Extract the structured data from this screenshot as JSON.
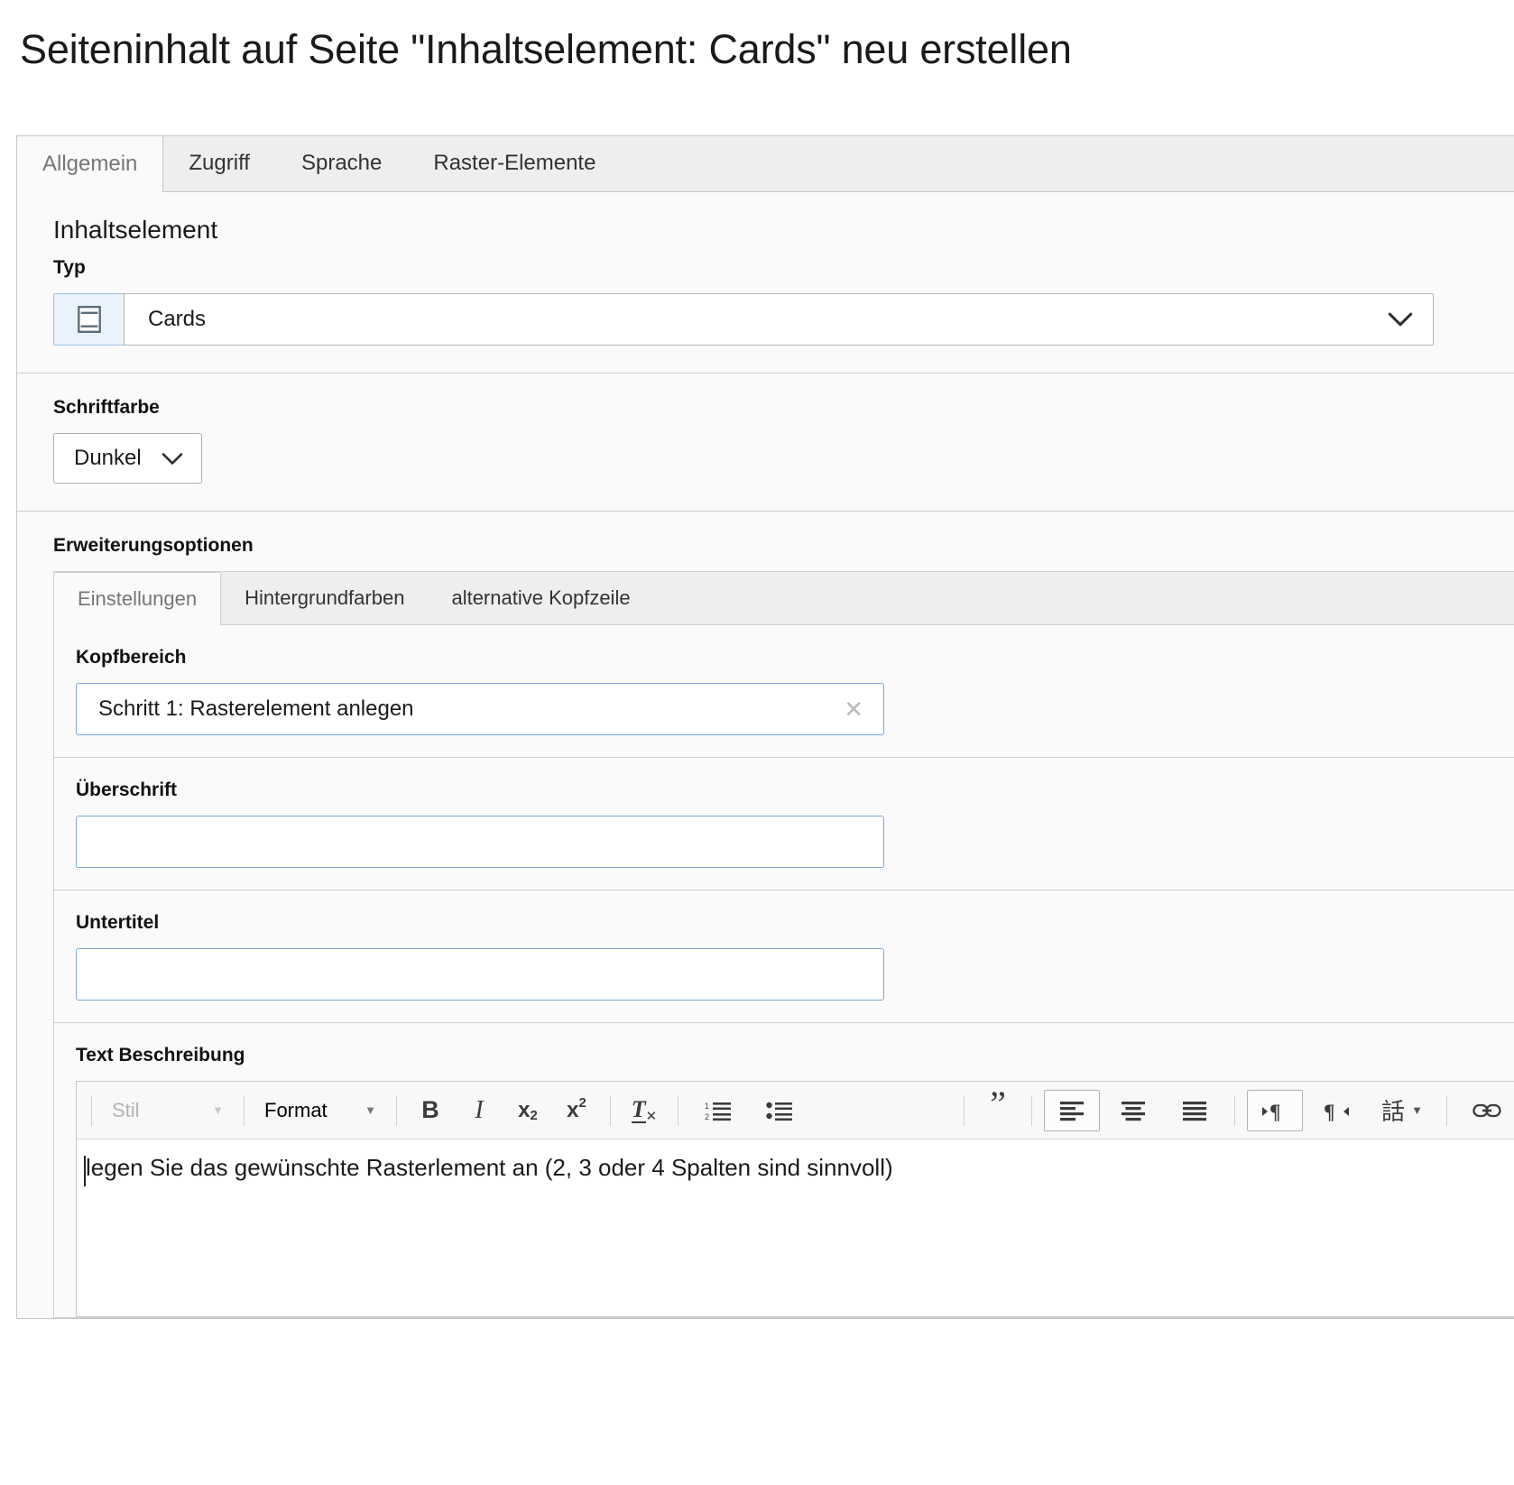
{
  "page": {
    "title": "Seiteninhalt auf Seite \"Inhaltselement: Cards\" neu erstellen"
  },
  "colors": {
    "panel_bg": "#fafafa",
    "tab_strip_bg": "#eeeeee",
    "border": "#c8c8c8",
    "input_focus_border": "#7aa7d9",
    "icon_box_bg": "#eaf2fb",
    "icon_box_border": "#9ec1e6",
    "text": "#1a1a1a",
    "muted_text": "#767676"
  },
  "tabs": {
    "items": [
      {
        "label": "Allgemein",
        "active": true
      },
      {
        "label": "Zugriff",
        "active": false
      },
      {
        "label": "Sprache",
        "active": false
      },
      {
        "label": "Raster-Elemente",
        "active": false
      }
    ]
  },
  "content_element": {
    "heading": "Inhaltselement",
    "type_field": {
      "label": "Typ",
      "icon": "content-card-icon",
      "value": "Cards",
      "chevron": "chevron-down-icon"
    }
  },
  "font_color": {
    "label": "Schriftfarbe",
    "value": "Dunkel",
    "chevron": "chevron-down-icon"
  },
  "extension_options": {
    "label": "Erweiterungsoptionen",
    "tabs": [
      {
        "label": "Einstellungen",
        "active": true
      },
      {
        "label": "Hintergrundfarben",
        "active": false
      },
      {
        "label": "alternative Kopfzeile",
        "active": false
      }
    ],
    "fields": [
      {
        "label": "Kopfbereich",
        "value": "Schritt 1: Rasterelement anlegen",
        "placeholder": "",
        "has_clear": true,
        "clear_icon": "close-x-icon"
      },
      {
        "label": "Überschrift",
        "value": "",
        "placeholder": "",
        "has_clear": false
      },
      {
        "label": "Untertitel",
        "value": "",
        "placeholder": "",
        "has_clear": false
      }
    ],
    "rte_field": {
      "label": "Text Beschreibung",
      "content": "legen Sie das gewünschte Rasterlement an (2, 3 oder 4 Spalten sind sinnvoll)",
      "toolbar": {
        "style_combo": {
          "label": "Stil",
          "disabled": true,
          "icon": "caret-down-icon"
        },
        "format_combo": {
          "label": "Format",
          "disabled": false,
          "icon": "caret-down-icon"
        },
        "buttons": [
          {
            "name": "bold-icon",
            "glyph": "B",
            "active": false,
            "disabled": false
          },
          {
            "name": "italic-icon",
            "glyph": "I",
            "active": false,
            "disabled": false
          },
          {
            "name": "subscript-icon",
            "glyph": "x₂",
            "active": false,
            "disabled": false
          },
          {
            "name": "superscript-icon",
            "glyph": "x²",
            "active": false,
            "disabled": false
          },
          {
            "name": "remove-format-icon",
            "glyph": "Tx",
            "active": false,
            "disabled": false
          },
          {
            "name": "numbered-list-icon",
            "glyph": "",
            "active": false,
            "disabled": false
          },
          {
            "name": "bulleted-list-icon",
            "glyph": "",
            "active": false,
            "disabled": false
          },
          {
            "name": "blockquote-icon",
            "glyph": "”",
            "active": false,
            "disabled": false
          },
          {
            "name": "align-left-icon",
            "glyph": "",
            "active": true,
            "disabled": false
          },
          {
            "name": "align-center-icon",
            "glyph": "",
            "active": false,
            "disabled": false
          },
          {
            "name": "justify-icon",
            "glyph": "",
            "active": false,
            "disabled": false
          },
          {
            "name": "text-direction-ltr-icon",
            "glyph": "",
            "active": true,
            "disabled": false
          },
          {
            "name": "text-direction-rtl-icon",
            "glyph": "",
            "active": false,
            "disabled": false
          },
          {
            "name": "language-icon",
            "glyph": "話",
            "active": false,
            "disabled": false
          },
          {
            "name": "link-icon",
            "glyph": "",
            "active": false,
            "disabled": false
          },
          {
            "name": "unlink-icon",
            "glyph": "",
            "active": false,
            "disabled": true
          },
          {
            "name": "paste-as-plain-text-icon",
            "glyph": "",
            "active": false,
            "disabled": false
          }
        ]
      }
    }
  }
}
